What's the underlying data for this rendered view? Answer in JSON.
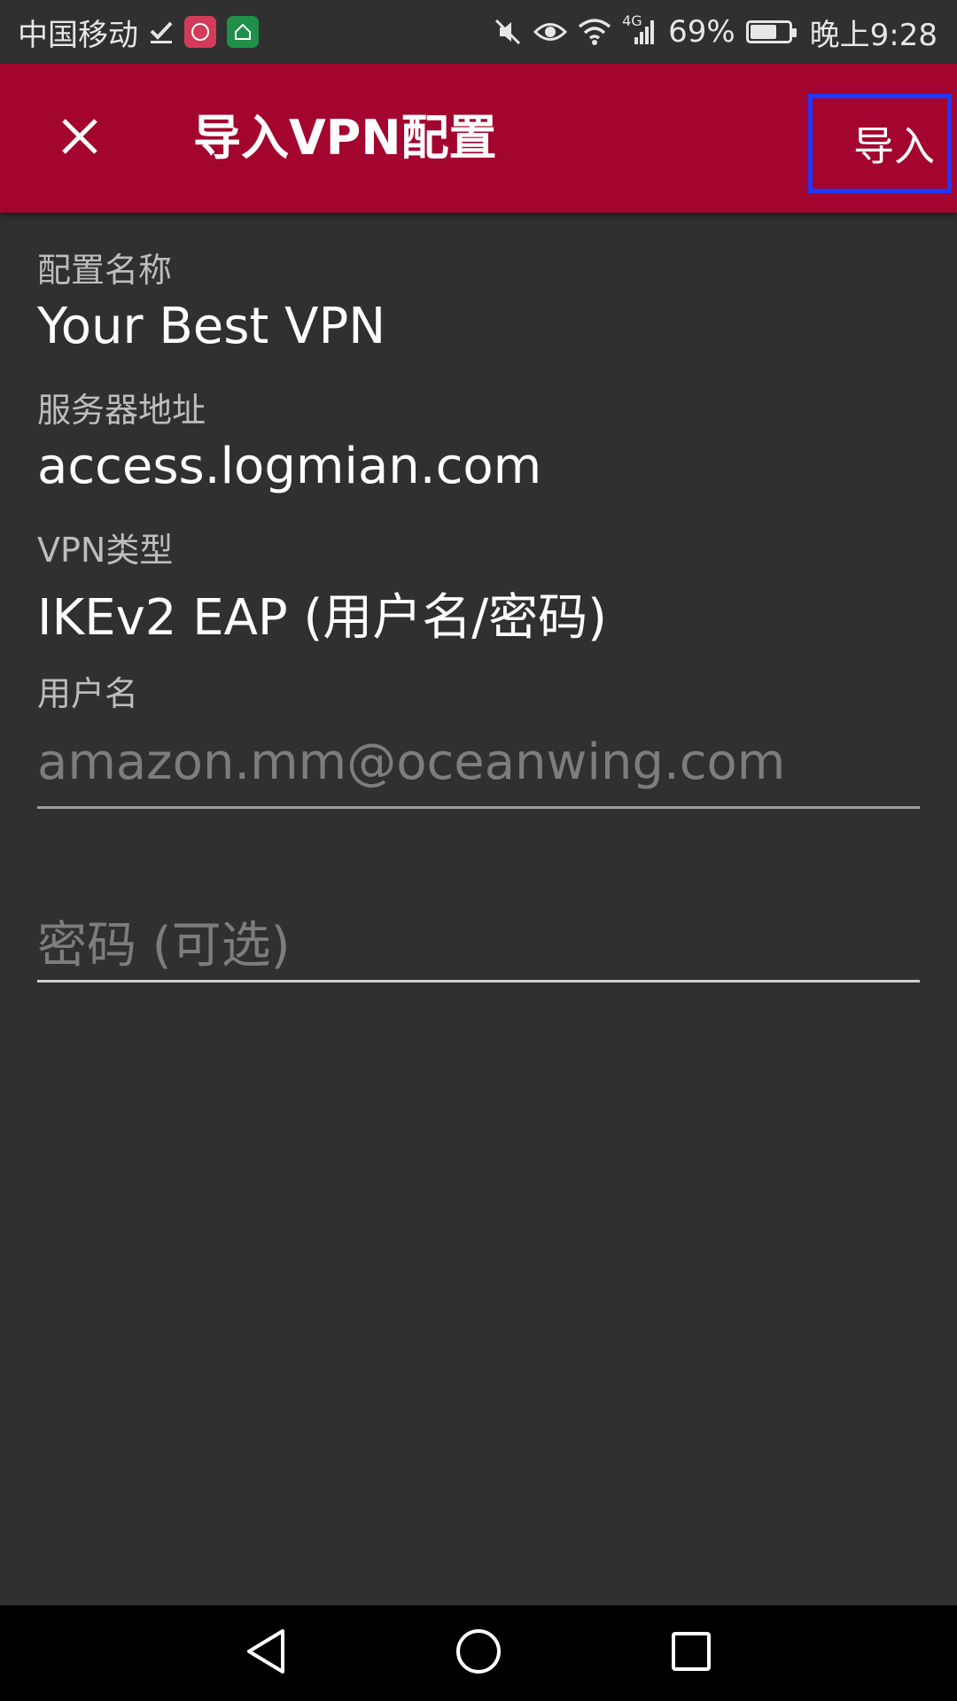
{
  "status_bar": {
    "carrier": "中国移动",
    "network": "4G",
    "battery": "69%",
    "battery_level": 0.69,
    "time": "晚上9:28",
    "icons": [
      "check-icon",
      "app-icon-pink",
      "app-icon-green",
      "mute-icon",
      "eye-icon",
      "wifi-icon",
      "signal-icon",
      "battery-icon"
    ]
  },
  "app_bar": {
    "title": "导入VPN配置",
    "import_label": "导入",
    "close_icon": "close-icon",
    "background": "#a3052e"
  },
  "form": {
    "profile_name_label": "配置名称",
    "profile_name_value": "Your Best VPN",
    "server_label": "服务器地址",
    "server_value": "access.logmian.com",
    "vpn_type_label": "VPN类型",
    "vpn_type_value": "IKEv2 EAP (用户名/密码)",
    "username_label": "用户名",
    "username_value": "amazon.mm@oceanwing.com",
    "password_placeholder": "密码 (可选)"
  },
  "nav_bar": {
    "icons": [
      "back-icon",
      "home-icon",
      "recents-icon"
    ]
  }
}
